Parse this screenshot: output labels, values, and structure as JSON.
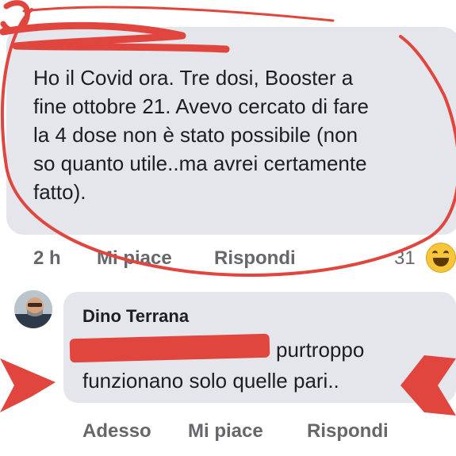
{
  "comment1": {
    "author": "",
    "text_lines": [
      "Ho il Covid ora. Tre dosi, Booster a",
      "fine ottobre 21. Avevo cercato di fare",
      "la 4 dose non è stato possibile (non",
      "so quanto utile..ma avrei certamente",
      "fatto)."
    ],
    "time": "2 h",
    "like_label": "Mi piace",
    "reply_label": "Rispondi",
    "reaction_count": "31",
    "reaction_icon": "laughing-emoji"
  },
  "comment2": {
    "author": "Dino Terrana",
    "text_line1": "purtroppo",
    "text_line2": "funzionano solo quelle pari..",
    "time": "Adesso",
    "like_label": "Mi piace",
    "reply_label": "Rispondi"
  },
  "colors": {
    "bubble": "#e4e6eb",
    "annotation_red": "#e0463e",
    "action_gray": "#65676b"
  }
}
